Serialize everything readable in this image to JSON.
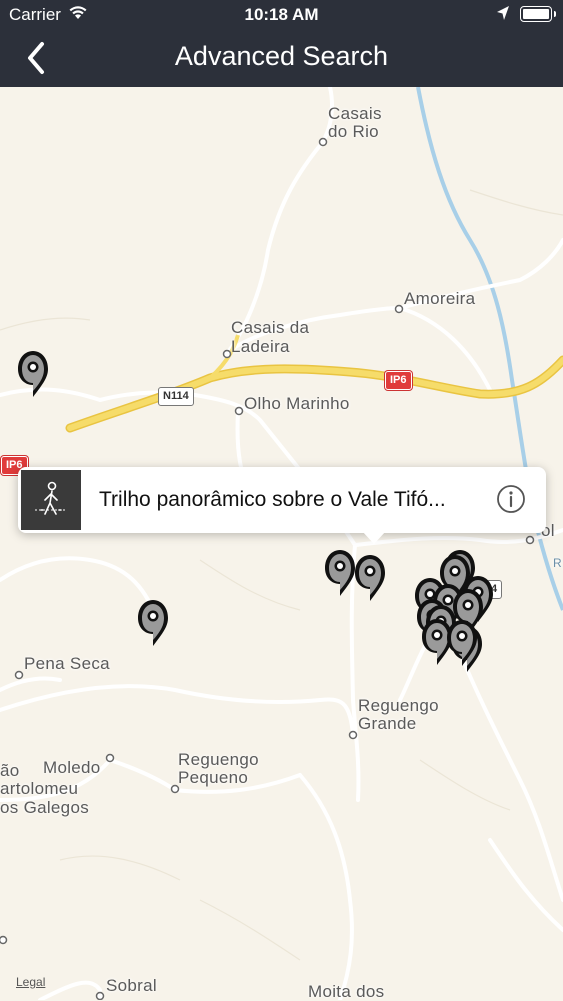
{
  "status_bar": {
    "carrier": "Carrier",
    "time": "10:18 AM"
  },
  "nav": {
    "title": "Advanced Search"
  },
  "map": {
    "places": {
      "casais_do_rio_1": "Casais",
      "casais_do_rio_2": "do Rio",
      "amoreira": "Amoreira",
      "casais_da_ladeira_1": "Casais da",
      "casais_da_ladeira_2": "Ladeira",
      "olho_marinho": "Olho Marinho",
      "pena_seca": "Pena Seca",
      "reguengo_grande_1": "Reguengo",
      "reguengo_grande_2": "Grande",
      "moledo": "Moledo",
      "reguengo_pequeno_1": "Reguengo",
      "reguengo_pequeno_2": "Pequeno",
      "sao_partial": "ão",
      "bartolomeu_partial": "artolomeu",
      "galegos_partial": "os Galegos",
      "sobral": "Sobral",
      "moita_dos": "Moita dos",
      "right_edge_partial": "ol",
      "right_edge_r": "R"
    },
    "roads": {
      "n114": "N114",
      "ip6_a": "IP6",
      "ip6_b": "IP6",
      "edge_4": "4"
    },
    "legal": "Legal",
    "colors": {
      "highway": "#f3d35a",
      "road": "#ffffff",
      "water": "#a8cfe8",
      "land": "#f7f3ea"
    }
  },
  "callout": {
    "title": "Trilho panorâmico sobre o Vale Tifó...",
    "icon": "hiker-icon",
    "info_icon": "info-icon"
  },
  "pin_icon": "map-pin-icon"
}
